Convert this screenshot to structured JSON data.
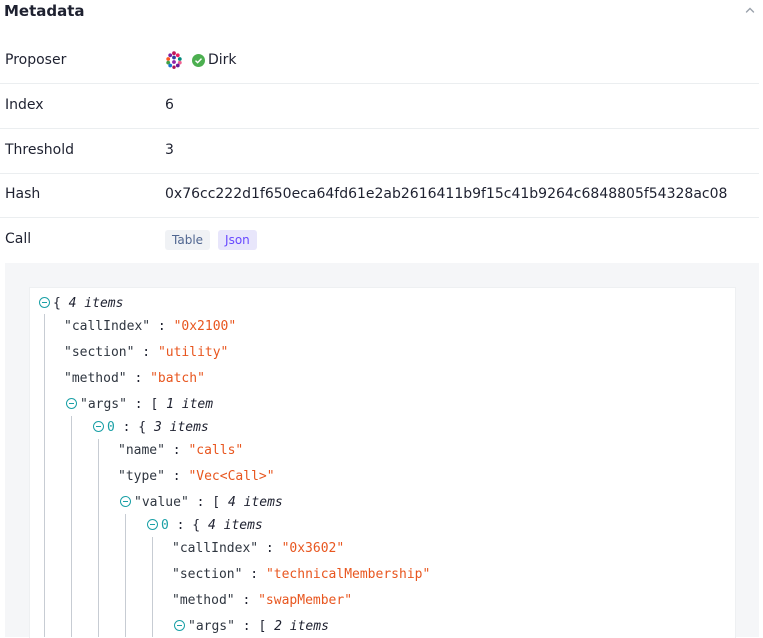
{
  "section": {
    "title": "Metadata"
  },
  "rows": {
    "proposer": {
      "label": "Proposer",
      "name": "Dirk"
    },
    "index": {
      "label": "Index",
      "value": "6"
    },
    "threshold": {
      "label": "Threshold",
      "value": "3"
    },
    "hash": {
      "label": "Hash",
      "value": "0x76cc222d1f650eca64fd61e2ab2616411b9f15c41b9264c6848805f54328ac08"
    },
    "call": {
      "label": "Call",
      "tabs": {
        "table": "Table",
        "json": "Json"
      }
    }
  },
  "json_view": {
    "root_count": "4 items",
    "callIndex_key": "\"callIndex\"",
    "callIndex_val": "\"0x2100\"",
    "section_key": "\"section\"",
    "section_val": "\"utility\"",
    "method_key": "\"method\"",
    "method_val": "\"batch\"",
    "args_key": "\"args\"",
    "args_count": "1 item",
    "item0_idx": "0",
    "item0_count": "3 items",
    "name_key": "\"name\"",
    "name_val": "\"calls\"",
    "type_key": "\"type\"",
    "type_val": "\"Vec<Call>\"",
    "value_key": "\"value\"",
    "value_count": "4 items",
    "sub0_idx": "0",
    "sub0_count": "4 items",
    "sub_callIndex_key": "\"callIndex\"",
    "sub_callIndex_val": "\"0x3602\"",
    "sub_section_key": "\"section\"",
    "sub_section_val": "\"technicalMembership\"",
    "sub_method_key": "\"method\"",
    "sub_method_val": "\"swapMember\"",
    "sub_args_key": "\"args\"",
    "sub_args_count": "2 items"
  },
  "colors": {
    "accent": "#6848ff",
    "string": "#e8561f",
    "toggle": "#1aa0a6",
    "status_ok": "#4caf50"
  }
}
